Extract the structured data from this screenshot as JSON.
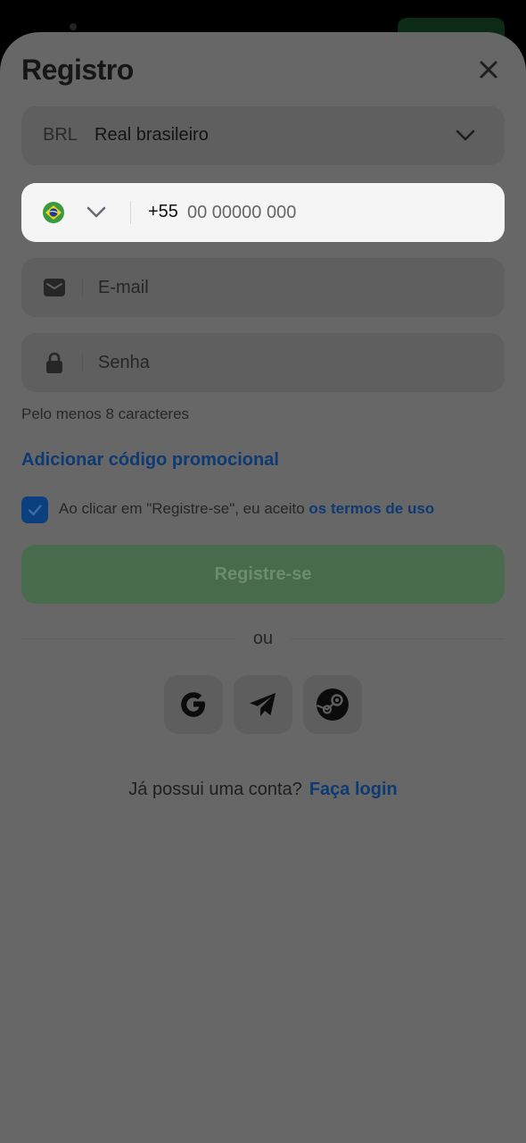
{
  "header": {
    "title": "Registro",
    "close_icon": "close-icon"
  },
  "currency": {
    "code": "BRL",
    "name": "Real brasileiro",
    "icon": "chevron-down-icon"
  },
  "phone": {
    "country_flag": "brazil-flag-icon",
    "prefix": "+55",
    "placeholder": "00 00000 000"
  },
  "email": {
    "icon": "envelope-icon",
    "placeholder": "E-mail"
  },
  "password": {
    "icon": "lock-icon",
    "placeholder": "Senha",
    "hint": "Pelo menos 8 caracteres"
  },
  "promo": {
    "link_label": "Adicionar código promocional"
  },
  "terms": {
    "checked": true,
    "text": "Ao clicar em \"Registre-se\", eu aceito ",
    "link_label": "os termos de uso"
  },
  "actions": {
    "register_label": "Registre-se",
    "or_label": "ou"
  },
  "social": [
    {
      "name": "google",
      "icon": "google-icon"
    },
    {
      "name": "telegram",
      "icon": "telegram-icon"
    },
    {
      "name": "steam",
      "icon": "steam-icon"
    }
  ],
  "login": {
    "prompt": "Já possui uma conta?",
    "link_label": "Faça login"
  },
  "colors": {
    "overlay": "#676767",
    "link": "#0d3a73",
    "register_button": "#476b4c",
    "phone_field_focused": "#f5f5f5"
  }
}
